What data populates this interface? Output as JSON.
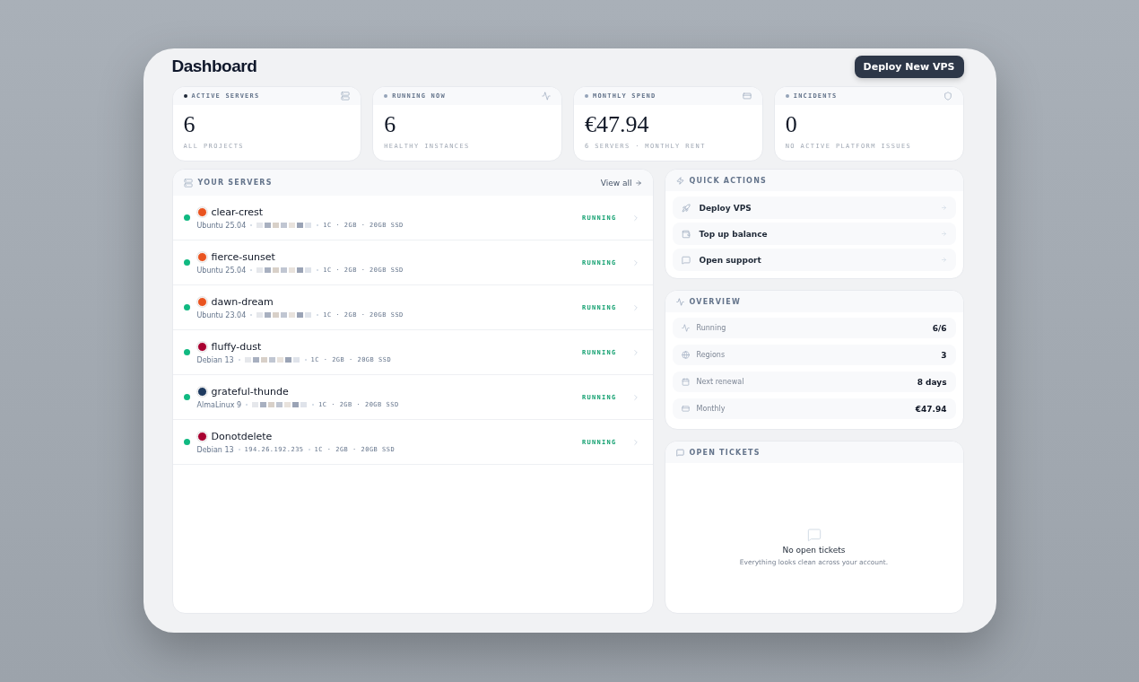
{
  "header": {
    "title": "Dashboard",
    "button": "Deploy New VPS"
  },
  "stats": [
    {
      "label": "ACTIVE SERVERS",
      "value": "6",
      "caption": "ALL PROJECTS",
      "color": "#1f2937"
    },
    {
      "label": "RUNNING NOW",
      "value": "6",
      "caption": "HEALTHY INSTANCES",
      "color": "#94a3b8"
    },
    {
      "label": "MONTHLY SPEND",
      "value": "€47.94",
      "caption": "6 SERVERS · MONTHLY RENT",
      "color": "#94a3b8"
    },
    {
      "label": "INCIDENTS",
      "value": "0",
      "caption": "NO ACTIVE PLATFORM ISSUES",
      "color": "#94a3b8"
    }
  ],
  "servers": {
    "title": "YOUR SERVERS",
    "link": "View all",
    "rows": [
      {
        "name": "clear-crest",
        "os": "Ubuntu 25.04",
        "color": "#e95420",
        "address": {
          "kind": "redacted"
        },
        "specs": "1C · 2GB · 20GB SSD",
        "status": "RUNNING"
      },
      {
        "name": "fierce-sunset",
        "os": "Ubuntu 25.04",
        "color": "#e95420",
        "address": {
          "kind": "redacted"
        },
        "specs": "1C · 2GB · 20GB SSD",
        "status": "RUNNING"
      },
      {
        "name": "dawn-dream",
        "os": "Ubuntu 23.04",
        "color": "#e95420",
        "address": {
          "kind": "redacted"
        },
        "specs": "1C · 2GB · 20GB SSD",
        "status": "RUNNING"
      },
      {
        "name": "fluffy-dust",
        "os": "Debian 13",
        "color": "#a80030",
        "address": {
          "kind": "redacted"
        },
        "specs": "1C · 2GB · 20GB SSD",
        "status": "RUNNING"
      },
      {
        "name": "grateful-thunde",
        "os": "AlmaLinux 9",
        "color": "#1e3a5f",
        "address": {
          "kind": "redacted"
        },
        "specs": "1C · 2GB · 20GB SSD",
        "status": "RUNNING"
      },
      {
        "name": "Donotdelete",
        "os": "Debian 13",
        "color": "#a80030",
        "address": {
          "kind": "text",
          "text": "194.26.192.235"
        },
        "specs": "1C · 2GB · 20GB SSD",
        "status": "RUNNING"
      }
    ]
  },
  "quick_actions": {
    "title": "QUICK ACTIONS",
    "items": [
      {
        "label": "Deploy VPS"
      },
      {
        "label": "Top up balance"
      },
      {
        "label": "Open support"
      }
    ]
  },
  "overview": {
    "title": "OVERVIEW",
    "items": [
      {
        "label": "Running",
        "value": "6/6"
      },
      {
        "label": "Regions",
        "value": "3"
      },
      {
        "label": "Next renewal",
        "value": "8 days"
      },
      {
        "label": "Monthly",
        "value": "€47.94"
      }
    ]
  },
  "tickets": {
    "title": "OPEN TICKETS",
    "empty_title": "No open tickets",
    "empty_text": "Everything looks clean across your account."
  }
}
